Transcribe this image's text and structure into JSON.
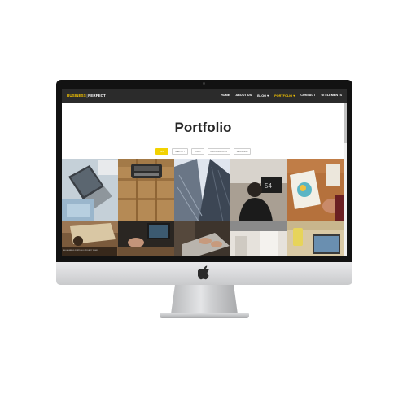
{
  "site": {
    "brand_primary": "BUSINESS",
    "brand_separator": "|",
    "brand_secondary": "PERFECT",
    "accent_color": "#f2c200"
  },
  "nav": {
    "items": [
      {
        "label": "HOME",
        "active": false
      },
      {
        "label": "ABOUT US",
        "active": false
      },
      {
        "label": "BLOG ▾",
        "active": false
      },
      {
        "label": "PORTFOLIO ▾",
        "active": true
      },
      {
        "label": "CONTACT",
        "active": false
      },
      {
        "label": "UI ELEMENTS",
        "active": false
      }
    ]
  },
  "page": {
    "title": "Portfolio"
  },
  "filters": [
    {
      "label": "ALL",
      "active": true
    },
    {
      "label": "IDENTITY",
      "active": false
    },
    {
      "label": "LOGO",
      "active": false
    },
    {
      "label": "ILLUSTRATIONS",
      "active": false
    },
    {
      "label": "BRANDING",
      "active": false
    }
  ],
  "portfolio": {
    "caption": "BLUMENFELD PORTFOLIO PROJECT DEMO"
  },
  "device": {
    "logo_icon": "apple-icon"
  }
}
